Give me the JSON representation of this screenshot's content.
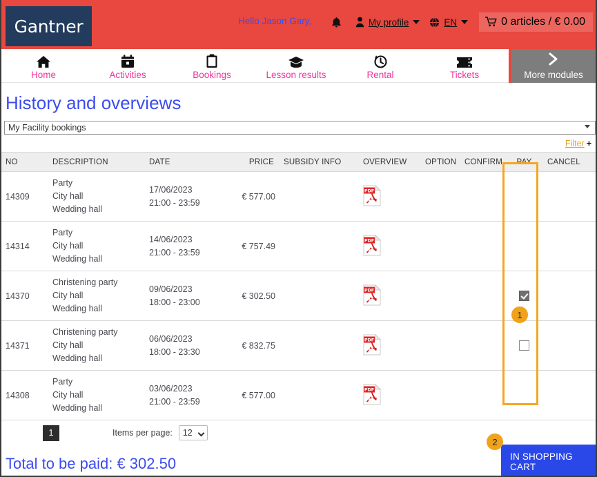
{
  "header": {
    "logo_text": "Gantner",
    "greeting": "Hello Jason Gary,",
    "bell_icon": "bell-icon",
    "profile_icon": "user-icon",
    "profile_label": "My profile",
    "globe_icon": "globe-icon",
    "language": "EN",
    "cart_icon": "shopping-cart-icon",
    "cart_label": "0 articles / € 0.00",
    "bg_color": "#e8483f",
    "logo_bg_color": "#233b5c"
  },
  "nav": {
    "items": [
      {
        "label": "Home",
        "icon": "home-icon"
      },
      {
        "label": "Activities",
        "icon": "calendar-icon"
      },
      {
        "label": "Bookings",
        "icon": "clipboard-icon"
      },
      {
        "label": "Lesson results",
        "icon": "graduation-cap-icon"
      },
      {
        "label": "Rental",
        "icon": "clock-history-icon"
      },
      {
        "label": "Tickets",
        "icon": "ticket-icon"
      }
    ],
    "more": {
      "label": "More modules",
      "icon": "chevron-right-icon"
    },
    "label_color": "#f0329b",
    "more_bg_color": "#7d7d7d"
  },
  "page": {
    "title": "History and overviews",
    "title_color": "#3b4cf0"
  },
  "facility_select": {
    "value": "My Facility bookings"
  },
  "filter": {
    "label": "Filter",
    "plus": "+",
    "color": "#e8a317"
  },
  "table": {
    "headers": [
      "NO",
      "DESCRIPTION",
      "DATE",
      "PRICE",
      "SUBSIDY INFO",
      "OVERVIEW",
      "OPTION",
      "CONFIRM",
      "PAY",
      "CANCEL"
    ],
    "rows": [
      {
        "no": "14309",
        "desc_1": "Party",
        "desc_2": "City hall",
        "desc_3": "Wedding hall",
        "date": "17/06/2023",
        "time": "21:00 - 23:59",
        "price": "€ 577.00",
        "subsidy": "",
        "overview_icon": "pdf-file-icon",
        "option": "",
        "confirm": "",
        "pay_checkbox": "none",
        "cancel": ""
      },
      {
        "no": "14314",
        "desc_1": "Party",
        "desc_2": "City hall",
        "desc_3": "Wedding hall",
        "date": "14/06/2023",
        "time": "21:00 - 23:59",
        "price": "€ 757.49",
        "subsidy": "",
        "overview_icon": "pdf-file-icon",
        "option": "",
        "confirm": "",
        "pay_checkbox": "none",
        "cancel": ""
      },
      {
        "no": "14370",
        "desc_1": "Christening party",
        "desc_2": "City hall",
        "desc_3": "Wedding hall",
        "date": "09/06/2023",
        "time": "18:00 - 23:00",
        "price": "€ 302.50",
        "subsidy": "",
        "overview_icon": "pdf-file-icon",
        "option": "",
        "confirm": "",
        "pay_checkbox": "checked",
        "cancel": ""
      },
      {
        "no": "14371",
        "desc_1": "Christening party",
        "desc_2": "City hall",
        "desc_3": "Wedding hall",
        "date": "06/06/2023",
        "time": "18:00 - 23:30",
        "price": "€ 832.75",
        "subsidy": "",
        "overview_icon": "pdf-file-icon",
        "option": "",
        "confirm": "",
        "pay_checkbox": "unchecked",
        "cancel": ""
      },
      {
        "no": "14308",
        "desc_1": "Party",
        "desc_2": "City hall",
        "desc_3": "Wedding hall",
        "date": "03/06/2023",
        "time": "21:00 - 23:59",
        "price": "€ 577.00",
        "subsidy": "",
        "overview_icon": "pdf-file-icon",
        "option": "",
        "confirm": "",
        "pay_checkbox": "none",
        "cancel": ""
      }
    ]
  },
  "pagination": {
    "current_page": "1",
    "items_per_page_label": "Items per page:",
    "items_per_page_value": "12"
  },
  "footer": {
    "total_label": "Total to be paid: € 302.50",
    "total_color": "#3b4cf0",
    "cart_button_label": "IN SHOPPING CART",
    "cart_button_color": "#2a48e8"
  },
  "annotations": {
    "badge_1": "1",
    "badge_2": "2",
    "badge_color": "#f0a21b",
    "highlight_color": "#f5a623"
  }
}
